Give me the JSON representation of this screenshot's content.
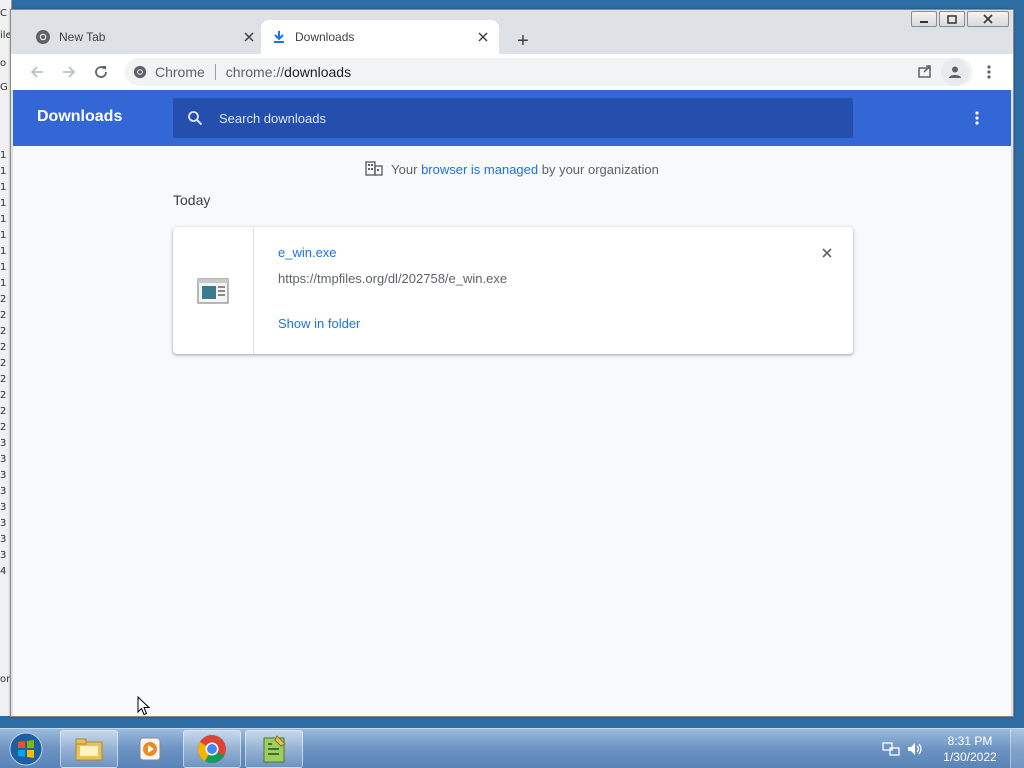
{
  "browser": {
    "tabs": [
      {
        "label": "New Tab",
        "icon": "chrome-icon",
        "active": false
      },
      {
        "label": "Downloads",
        "icon": "download-icon",
        "active": true
      }
    ],
    "new_tab_symbol": "+",
    "omnibox": {
      "chip_label": "Chrome",
      "url_scheme": "chrome://",
      "url_path": "downloads"
    }
  },
  "downloads": {
    "title": "Downloads",
    "search_placeholder": "Search downloads",
    "managed_prefix": "Your ",
    "managed_link": "browser is managed",
    "managed_suffix": " by your organization",
    "section_label": "Today",
    "items": [
      {
        "file_name": "e_win.exe",
        "url": "https://tmpfiles.org/dl/202758/e_win.exe",
        "action_label": "Show in folder"
      }
    ]
  },
  "taskbar": {
    "time": "8:31 PM",
    "date": "1/30/2022",
    "pinned": [
      "file-explorer-icon",
      "media-player-icon",
      "chrome-icon",
      "notepad-plus-plus-icon"
    ]
  },
  "desktop": {
    "left_fragments": [
      "C",
      "ile",
      "o",
      "G",
      "1",
      "1",
      "1",
      "1",
      "1",
      "1",
      "1",
      "1",
      "1",
      "2",
      "2",
      "2",
      "2",
      "2",
      "2",
      "2",
      "2",
      "2",
      "3",
      "3",
      "3",
      "3",
      "3",
      "3",
      "3",
      "3",
      "4",
      "or"
    ]
  },
  "colors": {
    "header_blue": "#3367d6",
    "link_blue": "#1a73e8",
    "search_bg": "#254fad",
    "page_bg": "#f8f9fa"
  }
}
